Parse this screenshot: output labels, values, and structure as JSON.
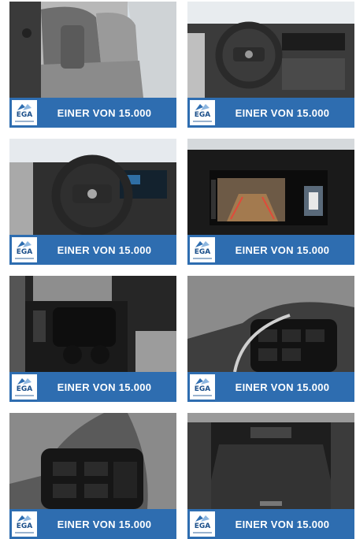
{
  "gallery": {
    "tiles": [
      {
        "label": "EINER VON 15.000",
        "logo_text": "EGA",
        "photo": "rear-seat-interior"
      },
      {
        "label": "EINER VON 15.000",
        "logo_text": "EGA",
        "photo": "steering-wheel-dashboard"
      },
      {
        "label": "EINER VON 15.000",
        "logo_text": "EGA",
        "photo": "steering-wheel-instrument-cluster"
      },
      {
        "label": "EINER VON 15.000",
        "logo_text": "EGA",
        "photo": "rear-camera-display"
      },
      {
        "label": "EINER VON 15.000",
        "logo_text": "EGA",
        "photo": "center-console"
      },
      {
        "label": "EINER VON 15.000",
        "logo_text": "EGA",
        "photo": "steering-wheel-buttons-right"
      },
      {
        "label": "EINER VON 15.000",
        "logo_text": "EGA",
        "photo": "steering-wheel-buttons-left"
      },
      {
        "label": "EINER VON 15.000",
        "logo_text": "EGA",
        "photo": "trunk-cargo-area"
      }
    ],
    "banner_color": "#2e6db0"
  }
}
